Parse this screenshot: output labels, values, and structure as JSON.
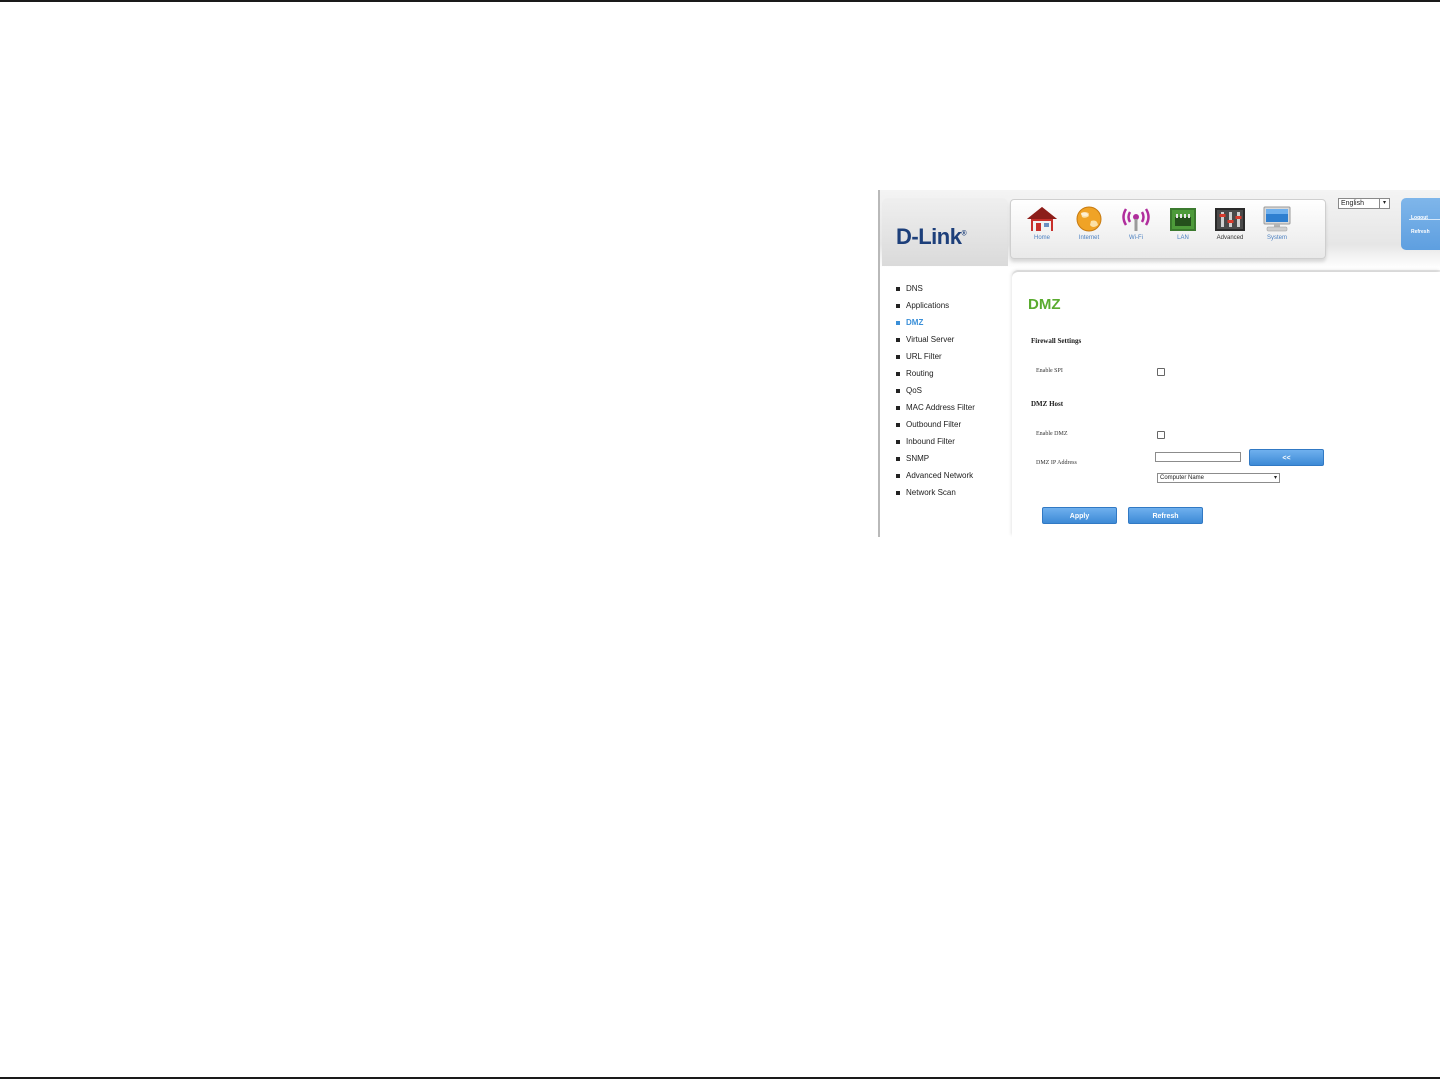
{
  "logo": {
    "text": "D-Link",
    "mark": "®"
  },
  "nav": [
    {
      "label": "Home",
      "icon": "home-icon"
    },
    {
      "label": "Internet",
      "icon": "globe-icon"
    },
    {
      "label": "Wi-Fi",
      "icon": "wifi-icon"
    },
    {
      "label": "LAN",
      "icon": "lan-icon"
    },
    {
      "label": "Advanced",
      "icon": "advanced-icon",
      "active": true
    },
    {
      "label": "System",
      "icon": "system-icon"
    }
  ],
  "language": {
    "selected": "English"
  },
  "user_panel": {
    "logout": "Logout",
    "refresh": "Refresh"
  },
  "menu": [
    "DNS",
    "Applications",
    "DMZ",
    "Virtual Server",
    "URL Filter",
    "Routing",
    "QoS",
    "MAC Address Filter",
    "Outbound Filter",
    "Inbound Filter",
    "SNMP",
    "Advanced Network",
    "Network Scan"
  ],
  "menu_active": "DMZ",
  "page": {
    "title": "DMZ",
    "firewall_section": "Firewall Settings",
    "enable_spi_label": "Enable SPI",
    "dmz_section": "DMZ Host",
    "enable_dmz_label": "Enable DMZ",
    "dmz_ip_label": "DMZ IP Address",
    "dmz_ip_value": "",
    "copy_button": "<<",
    "computer_select": "Computer Name",
    "apply_button": "Apply",
    "refresh_button": "Refresh"
  },
  "colors": {
    "accent_blue": "#3a8fd8",
    "title_green": "#5aab2f",
    "logo_navy": "#1d3f7a"
  }
}
